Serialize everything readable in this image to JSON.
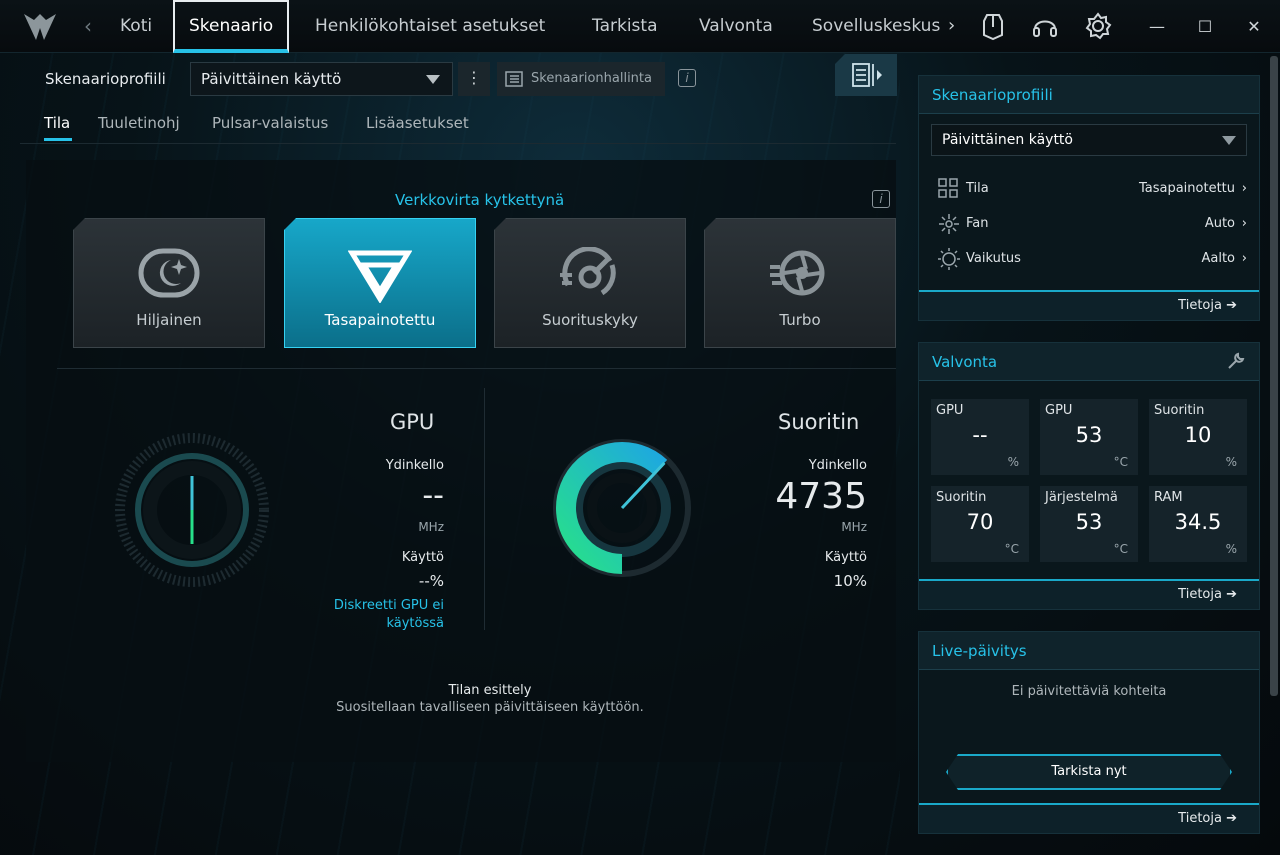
{
  "nav": {
    "tabs": [
      "Koti",
      "Skenaario",
      "Henkilökohtaiset asetukset",
      "Tarkista",
      "Valvonta",
      "Sovelluskeskus"
    ],
    "active": "Skenaario"
  },
  "icons": {
    "logo": "predator-logo-icon",
    "back": "chevron-left-icon",
    "forward": "chevron-right-icon",
    "toolbar": [
      "hardware-icon",
      "headset-icon",
      "gear-icon"
    ],
    "window": [
      "minimize-icon",
      "maximize-icon",
      "close-icon"
    ]
  },
  "window": {
    "min": "—",
    "max": "☐",
    "close": "✕"
  },
  "toolbar": {
    "profile_label": "Skenaarioprofiili",
    "profile_value": "Päivittäinen käyttö",
    "manager_label": "Skenaarionhallinta"
  },
  "subtabs": [
    "Tila",
    "Tuuletinohj",
    "Pulsar-valaistus",
    "Lisäasetukset"
  ],
  "modes": {
    "caption": "Verkkovirta kytkettynä",
    "items": [
      "Hiljainen",
      "Tasapainotettu",
      "Suorituskyky",
      "Turbo"
    ],
    "active_index": 1
  },
  "gpu": {
    "title": "GPU",
    "clock_label": "Ydinkello",
    "clock_value": "--",
    "clock_unit": "MHz",
    "usage_label": "Käyttö",
    "usage_value": "--%",
    "note_line1": "Diskreetti GPU ei",
    "note_line2": "käytössä"
  },
  "cpu": {
    "title": "Suoritin",
    "clock_label": "Ydinkello",
    "clock_value": "4735",
    "clock_unit": "MHz",
    "usage_label": "Käyttö",
    "usage_value": "10%",
    "gauge_percent": 62
  },
  "mode_info": {
    "title": "Tilan esittely",
    "desc": "Suositellaan tavalliseen päivittäiseen käyttöön."
  },
  "right": {
    "profile": {
      "title": "Skenaarioprofiili",
      "value": "Päivittäinen käyttö",
      "rows": [
        {
          "key": "Tila",
          "value": "Tasapainotettu",
          "icon": "grid-icon"
        },
        {
          "key": "Fan",
          "value": "Auto",
          "icon": "fan-icon"
        },
        {
          "key": "Vaikutus",
          "value": "Aalto",
          "icon": "light-icon"
        }
      ],
      "footer": "Tietoja"
    },
    "monitor": {
      "title": "Valvonta",
      "tiles": [
        {
          "name": "GPU",
          "value": "--",
          "unit": "%"
        },
        {
          "name": "GPU",
          "value": "53",
          "unit": "°C"
        },
        {
          "name": "Suoritin",
          "value": "10",
          "unit": "%"
        },
        {
          "name": "Suoritin",
          "value": "70",
          "unit": "°C"
        },
        {
          "name": "Järjestelmä",
          "value": "53",
          "unit": "°C"
        },
        {
          "name": "RAM",
          "value": "34.5",
          "unit": "%"
        }
      ],
      "footer": "Tietoja"
    },
    "live": {
      "title": "Live-päivitys",
      "empty": "Ei päivitettäviä kohteita",
      "button": "Tarkista nyt",
      "footer": "Tietoja"
    }
  },
  "colors": {
    "accent": "#27c2e8",
    "gauge_green": "#27e08a",
    "gauge_blue": "#1ea8e0"
  }
}
